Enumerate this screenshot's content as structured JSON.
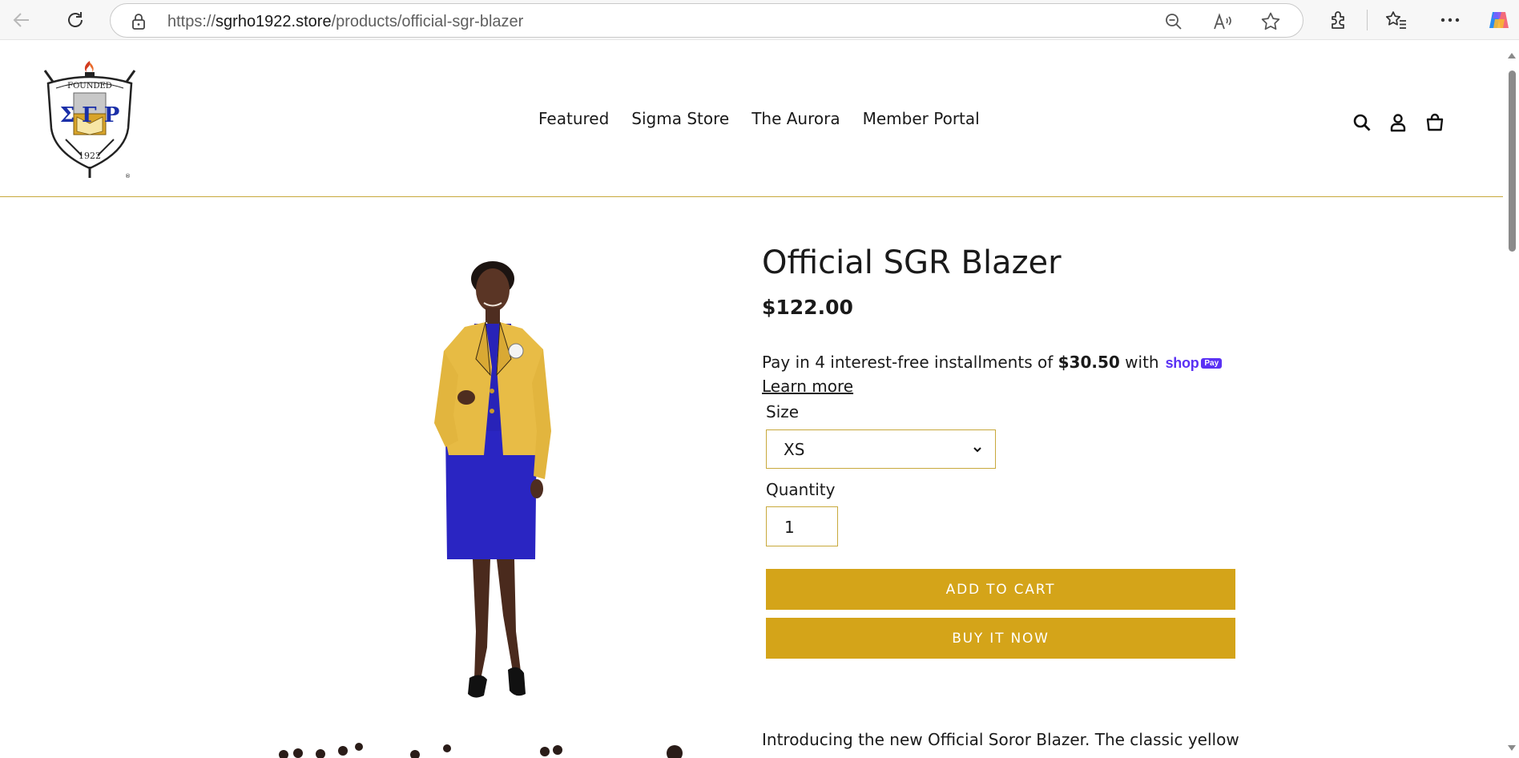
{
  "browser": {
    "url_prefix": "https://",
    "url_host": "sgrho1922.store",
    "url_path": "/products/official-sgr-blazer"
  },
  "site": {
    "nav": [
      {
        "label": "Featured"
      },
      {
        "label": "Sigma Store"
      },
      {
        "label": "The Aurora"
      },
      {
        "label": "Member Portal"
      }
    ],
    "logo_text": {
      "top": "FOUNDED",
      "letters": "Σ Γ Ρ",
      "year": "1922",
      "mark": "®"
    },
    "accent_color": "#c8a93c",
    "button_color": "#d4a419"
  },
  "product": {
    "title": "Official SGR Blazer",
    "price": "$122.00",
    "installments_prefix": "Pay in 4 interest-free installments of ",
    "installments_amount": "$30.50",
    "installments_suffix": " with",
    "shop_pay_word": "shop",
    "shop_pay_badge": "Pay",
    "learn_more": "Learn more",
    "size_label": "Size",
    "size_value": "XS",
    "quantity_label": "Quantity",
    "quantity_value": "1",
    "add_to_cart": "ADD TO CART",
    "buy_now": "BUY IT NOW",
    "description_line1": "Introducing the new Official Soror Blazer. The classic yellow"
  },
  "icons": {
    "browser": [
      "back-icon",
      "refresh-icon",
      "lock-icon",
      "zoom-out-icon",
      "read-aloud-icon",
      "favorite-star-icon",
      "extensions-icon",
      "favorites-icon",
      "more-icon",
      "copilot-icon"
    ],
    "header": [
      "search-icon",
      "account-icon",
      "cart-icon"
    ]
  }
}
